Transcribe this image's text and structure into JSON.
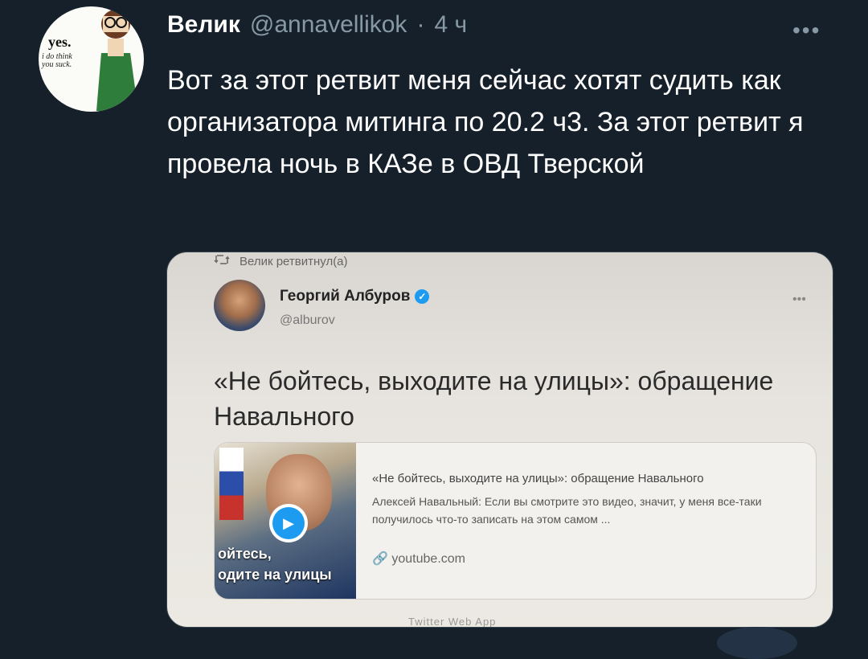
{
  "author": {
    "display_name": "Велик",
    "handle": "@annavellikok",
    "separator": "·",
    "time": "4 ч",
    "avatar_text": {
      "big": "yes.",
      "line1": "i do think",
      "line2": "you suck."
    }
  },
  "more_label": "•••",
  "tweet_text": "Вот за этот ретвит меня сейчас хотят судить как организатора митинга по 20.2 ч3. За этот ретвит я провела ночь в КАЗе в ОВД Тверской",
  "photo": {
    "retweet_line": "Велик ретвитнул(а)",
    "retweet_icon": "retweet-icon",
    "inner_author": "Георгий Албуров",
    "inner_handle": "@alburov",
    "inner_more": "•••",
    "inner_text": "«Не бойтесь, выходите на улицы»: обращение Навального",
    "card": {
      "title": "«Не бойтесь, выходите на улицы»: обращение Навального",
      "description": "Алексей Навальный: Если вы смотрите это видео, значит, у меня все-таки получилось что-то записать на этом самом ...",
      "link": "youtube.com",
      "thumb_text_1": "ойтесь,",
      "thumb_text_2": "одите на улицы"
    },
    "footer_text": "Twitter Web App"
  },
  "colors": {
    "background": "#15202b",
    "secondary_text": "#8899a6",
    "accent": "#1d9bf0"
  }
}
